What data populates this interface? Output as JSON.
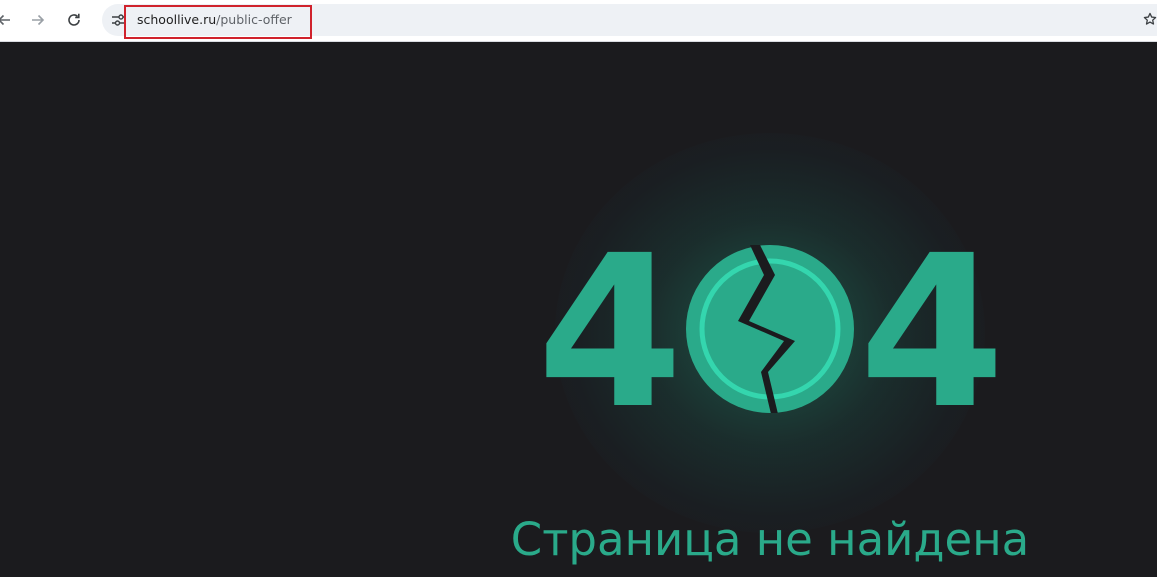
{
  "browser": {
    "url_domain": "schoollive.ru",
    "url_path": "/public-offer",
    "icons": {
      "back": "arrow-left-icon",
      "forward": "arrow-right-icon",
      "reload": "reload-icon",
      "site_info": "tune-icon",
      "bookmark": "star-icon"
    },
    "highlight_color": "#d0222c"
  },
  "page": {
    "error_code_left": "4",
    "error_code_right": "4",
    "error_title": "Страница не найдена",
    "accent_color": "#2aaa8a",
    "background_color": "#1b1b1e"
  }
}
